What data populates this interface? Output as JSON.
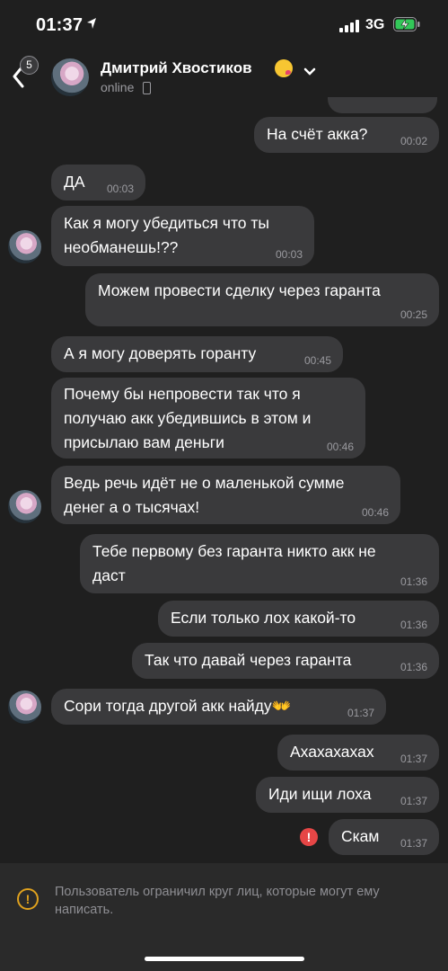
{
  "status_bar": {
    "time": "01:37",
    "network": "3G"
  },
  "header": {
    "back_badge": "5",
    "contact_name": "Дмитрий Хвостиков",
    "status": "online"
  },
  "messages": [
    {
      "text": "На счёт акка?",
      "time": "00:02",
      "direction": "out"
    },
    {
      "text": "ДА",
      "time": "00:03",
      "direction": "in"
    },
    {
      "text": "Как я могу убедиться что ты\nнеобманешь!??",
      "time": "00:03",
      "direction": "in"
    },
    {
      "text": "Можем провести сделку через гаранта",
      "time": "00:25",
      "direction": "out"
    },
    {
      "text": "А я могу доверять горанту",
      "time": "00:45",
      "direction": "in"
    },
    {
      "text": "Почему бы непровести так что я\nполучаю акк убедившись в этом и\nприсылаю вам деньги",
      "time": "00:46",
      "direction": "in"
    },
    {
      "text": "Ведь речь идёт не о маленькой сумме\nденег а о тысячах!",
      "time": "00:46",
      "direction": "in"
    },
    {
      "text": "Тебе первому без гаранта никто акк не\nдаст",
      "time": "01:36",
      "direction": "out"
    },
    {
      "text": "Если только лох какой-то",
      "time": "01:36",
      "direction": "out"
    },
    {
      "text": "Так что давай через гаранта",
      "time": "01:36",
      "direction": "out"
    },
    {
      "text": "Сори тогда другой акк найду👐",
      "time": "01:37",
      "direction": "in"
    },
    {
      "text": "Ахахахахах",
      "time": "01:37",
      "direction": "out"
    },
    {
      "text": "Иди ищи лоха",
      "time": "01:37",
      "direction": "out"
    },
    {
      "text": "Скам",
      "time": "01:37",
      "direction": "out",
      "failed": true
    }
  ],
  "error_mark": "!",
  "notice": {
    "icon": "warning-icon",
    "text": "Пользователь ограничил круг лиц, которые могут ему написать."
  },
  "colors": {
    "background": "#1f1f1f",
    "bubble": "#3a3a3c",
    "error": "#e64646",
    "warning": "#e0a21e"
  }
}
